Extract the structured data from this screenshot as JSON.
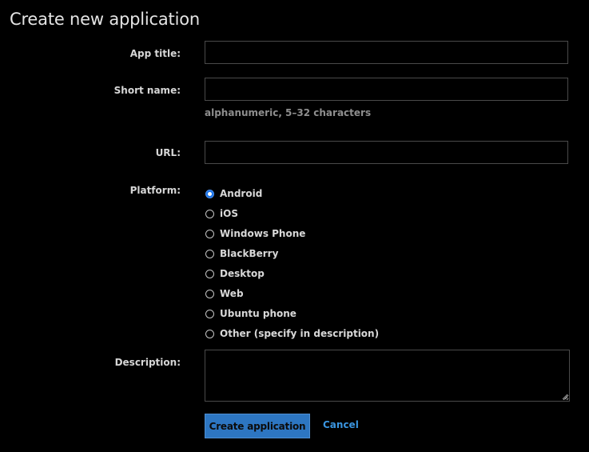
{
  "page": {
    "title": "Create new application"
  },
  "form": {
    "app_title": {
      "label": "App title:",
      "value": "",
      "placeholder": ""
    },
    "short_name": {
      "label": "Short name:",
      "value": "",
      "placeholder": "",
      "hint": "alphanumeric, 5–32 characters"
    },
    "url": {
      "label": "URL:",
      "value": "",
      "placeholder": ""
    },
    "platform": {
      "label": "Platform:",
      "selected": "Android",
      "options": [
        {
          "label": "Android",
          "checked": true
        },
        {
          "label": "iOS",
          "checked": false
        },
        {
          "label": "Windows Phone",
          "checked": false
        },
        {
          "label": "BlackBerry",
          "checked": false
        },
        {
          "label": "Desktop",
          "checked": false
        },
        {
          "label": "Web",
          "checked": false
        },
        {
          "label": "Ubuntu phone",
          "checked": false
        },
        {
          "label": "Other (specify in description)",
          "checked": false
        }
      ]
    },
    "description": {
      "label": "Description:",
      "value": "",
      "placeholder": ""
    },
    "actions": {
      "submit_label": "Create application",
      "cancel_label": "Cancel"
    }
  },
  "colors": {
    "background": "#000000",
    "primary_button": "#2d76c2",
    "link": "#3a95e0",
    "radio_checked": "#1a73e8",
    "hint_text": "#8e8e8e"
  }
}
